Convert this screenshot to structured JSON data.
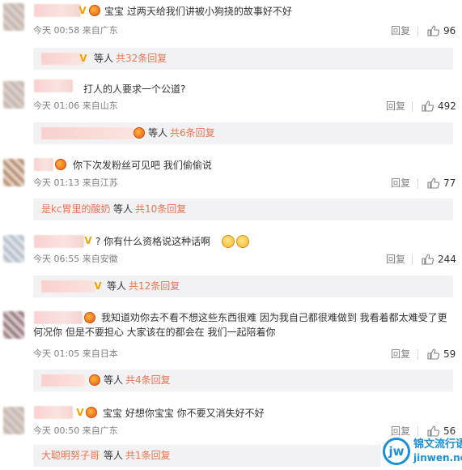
{
  "ui": {
    "reply_label": "回复",
    "others_label": "等人",
    "colors": {
      "link": "#eb7350",
      "meta": "#808080",
      "subbox_bg": "#f2f2f5",
      "watermark": "#1c8fd6"
    }
  },
  "comments": [
    {
      "text": "宝宝 过两天给我们讲被小狗挠的故事好不好",
      "time": "今天 00:58",
      "source": "来自广东",
      "likes": "96",
      "sub": {
        "total": "共32条回复"
      }
    },
    {
      "text": "打人的人要求一个公道?",
      "time": "今天 01:06",
      "source": "来自山东",
      "likes": "492",
      "sub": {
        "total": "共6条回复"
      }
    },
    {
      "text": "你下次发粉丝可见吧 我们偷偷说",
      "time": "今天 01:13",
      "source": "来自江苏",
      "likes": "77",
      "sub": {
        "name": "是kc胃里的酸奶",
        "total": "共10条回复"
      }
    },
    {
      "text": "? 你有什么资格说这种话啊",
      "time": "今天 06:55",
      "source": "来自安徽",
      "likes": "244",
      "sub": {
        "total": "共12条回复"
      }
    },
    {
      "text": "我知道劝你去不看不想这些东西很难 因为我自己都很难做到 我看着都太难受了更何况你 但是不要担心 大家该在的都会在 我们一起陪着你",
      "time": "今天 01:05",
      "source": "来自日本",
      "likes": "59",
      "sub": {
        "total": "共4条回复"
      }
    },
    {
      "text": "宝宝 好想你宝宝 你不要又消失好不好",
      "time": "今天 00:50",
      "source": "来自广东",
      "likes": "56",
      "sub": {
        "name": "大聪明努子哥",
        "total": "共1条回复"
      }
    }
  ],
  "watermark": {
    "logo": "jw",
    "name_cn": "锦文流行语",
    "domain": "jinwen.net"
  }
}
